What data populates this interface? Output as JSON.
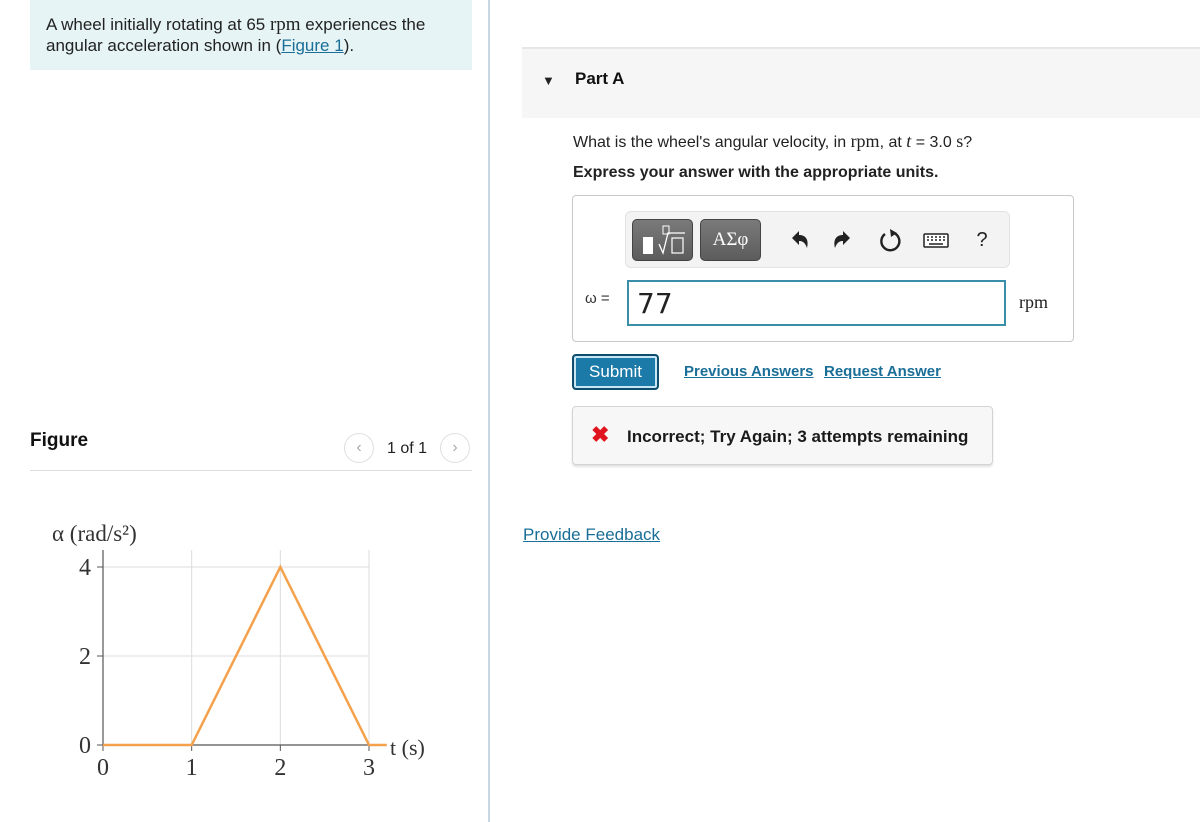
{
  "intro": {
    "text_before": "A wheel initially rotating at 65 ",
    "unit": "rpm",
    "text_after": " experiences the angular acceleration shown in (",
    "figure_link": "Figure 1",
    "text_end": ")."
  },
  "figure": {
    "title": "Figure",
    "pager_text": "1 of 1",
    "prev_glyph": "‹",
    "next_glyph": "›"
  },
  "part": {
    "caret": "▼",
    "title": "Part A",
    "question_before": "What is the wheel's angular velocity, in ",
    "question_unit": "rpm",
    "question_mid": ", at ",
    "question_var": "t",
    "question_eq": " = 3.0 ",
    "question_s": "s",
    "question_end": "?",
    "instruction": "Express your answer with the appropriate units."
  },
  "toolbar": {
    "symbols_label": "ΑΣφ",
    "help_label": "?"
  },
  "answer": {
    "variable_label": "ω =",
    "value": "77",
    "unit": "rpm"
  },
  "actions": {
    "submit": "Submit",
    "previous_answers": "Previous Answers",
    "request_answer": "Request Answer"
  },
  "feedback": {
    "icon": "✖",
    "message": "Incorrect; Try Again; 3 attempts remaining",
    "status_color": "#e0141e"
  },
  "provide_feedback": "Provide Feedback",
  "chart_data": {
    "type": "line",
    "title": "",
    "ylabel": "α (rad/s²)",
    "xlabel": "t (s)",
    "x_ticks": [
      "0",
      "1",
      "2",
      "3"
    ],
    "y_ticks": [
      "0",
      "2",
      "4"
    ],
    "xlim": [
      0,
      3.2
    ],
    "ylim": [
      0,
      4
    ],
    "grid": true,
    "series": [
      {
        "name": "alpha",
        "color": "#f5a04a",
        "x": [
          0,
          1,
          2,
          3,
          3.2
        ],
        "y": [
          0,
          0,
          4,
          0,
          0
        ]
      }
    ]
  }
}
